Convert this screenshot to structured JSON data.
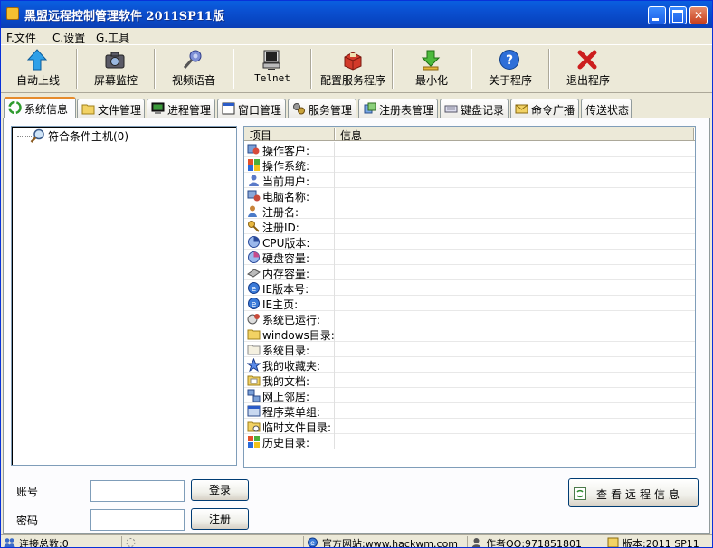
{
  "window": {
    "title": "黑盟远程控制管理软件 2011SP11版"
  },
  "menu": [
    {
      "key": "F",
      "label": "文件"
    },
    {
      "key": "C",
      "label": "设置"
    },
    {
      "key": "G",
      "label": "工具"
    }
  ],
  "toolbar": [
    {
      "label": "自动上线",
      "icon": "up-arrow-icon"
    },
    {
      "label": "屏幕监控",
      "icon": "camera-icon"
    },
    {
      "label": "视频语音",
      "icon": "microphone-icon"
    },
    {
      "label": "Telnet",
      "icon": "terminal-icon"
    },
    {
      "label": "配置服务程序",
      "icon": "config-package-icon"
    },
    {
      "label": "最小化",
      "icon": "minimize-down-icon"
    },
    {
      "label": "关于程序",
      "icon": "help-icon"
    },
    {
      "label": "退出程序",
      "icon": "exit-x-icon"
    }
  ],
  "tabs": [
    {
      "label": "系统信息",
      "active": true
    },
    {
      "label": "文件管理"
    },
    {
      "label": "进程管理"
    },
    {
      "label": "窗口管理"
    },
    {
      "label": "服务管理"
    },
    {
      "label": "注册表管理"
    },
    {
      "label": "键盘记录"
    },
    {
      "label": "命令广播"
    },
    {
      "label": "传送状态"
    }
  ],
  "tree": {
    "root_label": "符合条件主机(0)"
  },
  "info_table": {
    "columns": [
      "项目",
      "信息"
    ],
    "rows": [
      {
        "label": "操作客户:",
        "icon": "user-client-icon"
      },
      {
        "label": "操作系统:",
        "icon": "windows-flag-icon"
      },
      {
        "label": "当前用户:",
        "icon": "user-icon"
      },
      {
        "label": "电脑名称:",
        "icon": "computer-user-icon"
      },
      {
        "label": "注册名:",
        "icon": "registered-user-icon"
      },
      {
        "label": "注册ID:",
        "icon": "id-key-icon"
      },
      {
        "label": "CPU版本:",
        "icon": "cpu-pie-icon"
      },
      {
        "label": "硬盘容量:",
        "icon": "disk-pie-icon"
      },
      {
        "label": "内存容量:",
        "icon": "memory-icon"
      },
      {
        "label": "IE版本号:",
        "icon": "ie-icon"
      },
      {
        "label": "IE主页:",
        "icon": "ie-home-icon"
      },
      {
        "label": "系统已运行:",
        "icon": "clock-run-icon"
      },
      {
        "label": "windows目录:",
        "icon": "folder-icon"
      },
      {
        "label": "系统目录:",
        "icon": "system-folder-icon"
      },
      {
        "label": "我的收藏夹:",
        "icon": "star-icon"
      },
      {
        "label": "我的文档:",
        "icon": "documents-icon"
      },
      {
        "label": "网上邻居:",
        "icon": "network-icon"
      },
      {
        "label": "程序菜单组:",
        "icon": "program-menu-icon"
      },
      {
        "label": "临时文件目录:",
        "icon": "temp-folder-icon"
      },
      {
        "label": "历史目录:",
        "icon": "history-icon"
      }
    ]
  },
  "login": {
    "account_label": "账号",
    "password_label": "密码",
    "account_value": "",
    "password_value": "",
    "login_button": "登录",
    "register_button": "注册"
  },
  "view_remote_button": "查看远程信息",
  "status": {
    "connections": "连接总数:0",
    "website": "官方网站:www.hackwm.com",
    "author": "作者QQ:971851801",
    "version": "版本:2011 SP11"
  }
}
